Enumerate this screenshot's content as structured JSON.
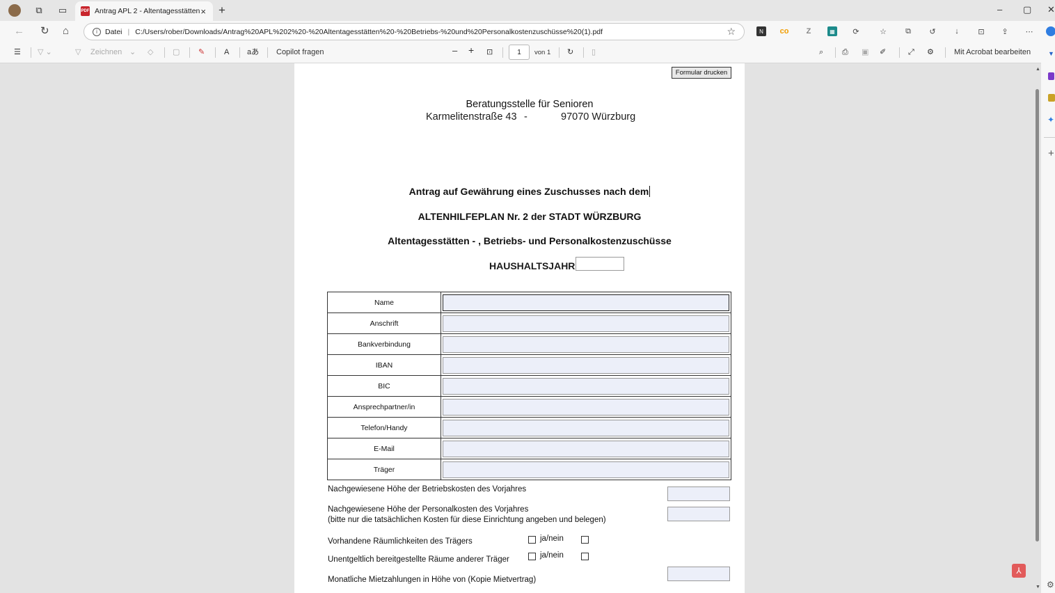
{
  "browser": {
    "tab_title": "Antrag APL 2 - Altentagesstätten",
    "tab_close": "×",
    "new_tab": "+",
    "window_controls": {
      "minimize": "–",
      "restore": "▢",
      "close": "✕"
    }
  },
  "address_bar": {
    "scheme_label": "Datei",
    "url": "C:/Users/rober/Downloads/Antrag%20APL%202%20-%20Altentagesstätten%20-%20Betriebs-%20und%20Personalkostenzuschüsse%20(1).pdf"
  },
  "pdf_toolbar": {
    "draw_label": "Zeichnen",
    "copilot_label": "Copilot fragen",
    "zoom_out": "–",
    "zoom_in": "+",
    "page_current": "1",
    "page_total_label": "von 1",
    "edit_acrobat_label": "Mit Acrobat bearbeiten",
    "read_aloud": "A",
    "translate": "aあ"
  },
  "document": {
    "print_button": "Formular drucken",
    "org_name": "Beratungsstelle für Senioren",
    "org_street": "Karmelitenstraße 43",
    "org_dash": "-",
    "org_city": "97070 Würzburg",
    "title_line1": "Antrag auf Gewährung eines Zuschusses nach dem",
    "title_line2": "ALTENHILFEPLAN Nr. 2 der STADT WÜRZBURG",
    "title_line3": "Altentagesstätten - , Betriebs- und Personalkostenzuschüsse",
    "year_label": "HAUSHALTSJAHR",
    "form_rows": [
      {
        "label": "Name",
        "value": ""
      },
      {
        "label": "Anschrift",
        "value": ""
      },
      {
        "label": "Bankverbindung",
        "value": ""
      },
      {
        "label": "IBAN",
        "value": ""
      },
      {
        "label": "BIC",
        "value": ""
      },
      {
        "label": "Ansprechpartner/in",
        "value": ""
      },
      {
        "label": "Telefon/Handy",
        "value": ""
      },
      {
        "label": "E-Mail",
        "value": ""
      },
      {
        "label": "Träger",
        "value": ""
      }
    ],
    "operating_costs_label": "Nachgewiesene Höhe der Betriebskosten des Vorjahres",
    "personnel_costs_label": "Nachgewiesene Höhe der Personalkosten des Vorjahres",
    "personnel_costs_note": "(bitte nur die tatsächlichen Kosten für diese Einrichtung angeben und belegen)",
    "rooms_own_label": "Vorhandene Räumlichkeiten des Trägers",
    "rooms_free_label": "Unentgeltlich bereitgestellte Räume anderer Träger",
    "yes_no_label": "ja/nein",
    "rent_label": "Monatliche Mietzahlungen in Höhe von (Kopie Mietvertrag)"
  },
  "colors": {
    "field_fill": "#eceff9",
    "chrome_bg": "#f7f7f7",
    "viewer_bg": "#e3e3e3",
    "acrobat_red": "#e25b5b"
  }
}
